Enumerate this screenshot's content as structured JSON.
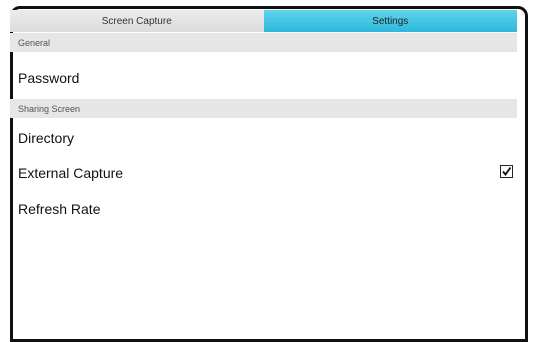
{
  "tabs": [
    {
      "label": "Screen Capture",
      "active": false
    },
    {
      "label": "Settings",
      "active": true
    }
  ],
  "sections": {
    "general": {
      "header": "General",
      "items": [
        {
          "label": "Password"
        }
      ]
    },
    "sharing": {
      "header": "Sharing Screen",
      "items": [
        {
          "label": "Directory"
        },
        {
          "label": "External Capture",
          "checked": true
        },
        {
          "label": "Refresh Rate"
        }
      ]
    }
  },
  "colors": {
    "active_tab": "#3cc3e3",
    "inactive_tab": "#e4e4e4",
    "section_header": "#e6e6e6"
  }
}
